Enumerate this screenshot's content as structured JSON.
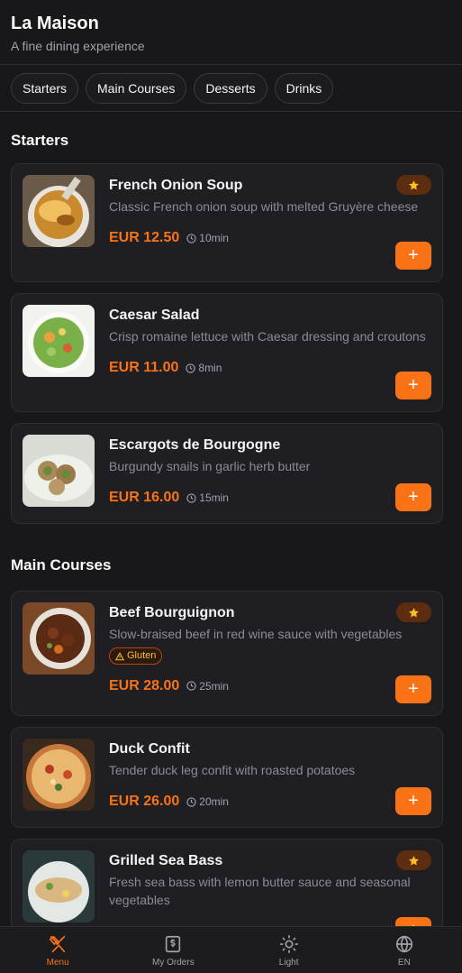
{
  "header": {
    "title": "La Maison",
    "subtitle": "A fine dining experience"
  },
  "tabs": [
    {
      "label": "Starters"
    },
    {
      "label": "Main Courses"
    },
    {
      "label": "Desserts"
    },
    {
      "label": "Drinks"
    }
  ],
  "sections": [
    {
      "title": "Starters",
      "items": [
        {
          "name": "French Onion Soup",
          "description": "Classic French onion soup with melted Gruyère cheese",
          "price": "EUR 12.50",
          "time": "10min",
          "featured": true,
          "image_icon": "onion-soup-photo"
        },
        {
          "name": "Caesar Salad",
          "description": "Crisp romaine lettuce with Caesar dressing and croutons",
          "price": "EUR 11.00",
          "time": "8min",
          "featured": false,
          "image_icon": "salad-photo"
        },
        {
          "name": "Escargots de Bourgogne",
          "description": "Burgundy snails in garlic herb butter",
          "price": "EUR 16.00",
          "time": "15min",
          "featured": false,
          "image_icon": "escargot-photo"
        }
      ]
    },
    {
      "title": "Main Courses",
      "items": [
        {
          "name": "Beef Bourguignon",
          "description": "Slow-braised beef in red wine sauce with vegetables",
          "badge": "Gluten",
          "price": "EUR 28.00",
          "time": "25min",
          "featured": true,
          "image_icon": "beef-stew-photo"
        },
        {
          "name": "Duck Confit",
          "description": "Tender duck leg confit with roasted potatoes",
          "price": "EUR 26.00",
          "time": "20min",
          "featured": false,
          "image_icon": "duck-photo"
        },
        {
          "name": "Grilled Sea Bass",
          "description": "Fresh sea bass with lemon butter sauce and seasonal vegetables",
          "featured": true,
          "image_icon": "sea-bass-photo"
        }
      ]
    }
  ],
  "add_label": "+",
  "nav": [
    {
      "label": "Menu",
      "icon": "utensils-icon",
      "active": true
    },
    {
      "label": "My Orders",
      "icon": "receipt-dollar-icon",
      "active": false
    },
    {
      "label": "Light",
      "icon": "sun-icon",
      "active": false
    },
    {
      "label": "EN",
      "icon": "globe-icon",
      "active": false
    }
  ],
  "colors": {
    "accent": "#f97316",
    "background": "#18181b",
    "card": "#1f1f23",
    "star_badge": "#5c2d0e",
    "star": "#fbbf24"
  }
}
